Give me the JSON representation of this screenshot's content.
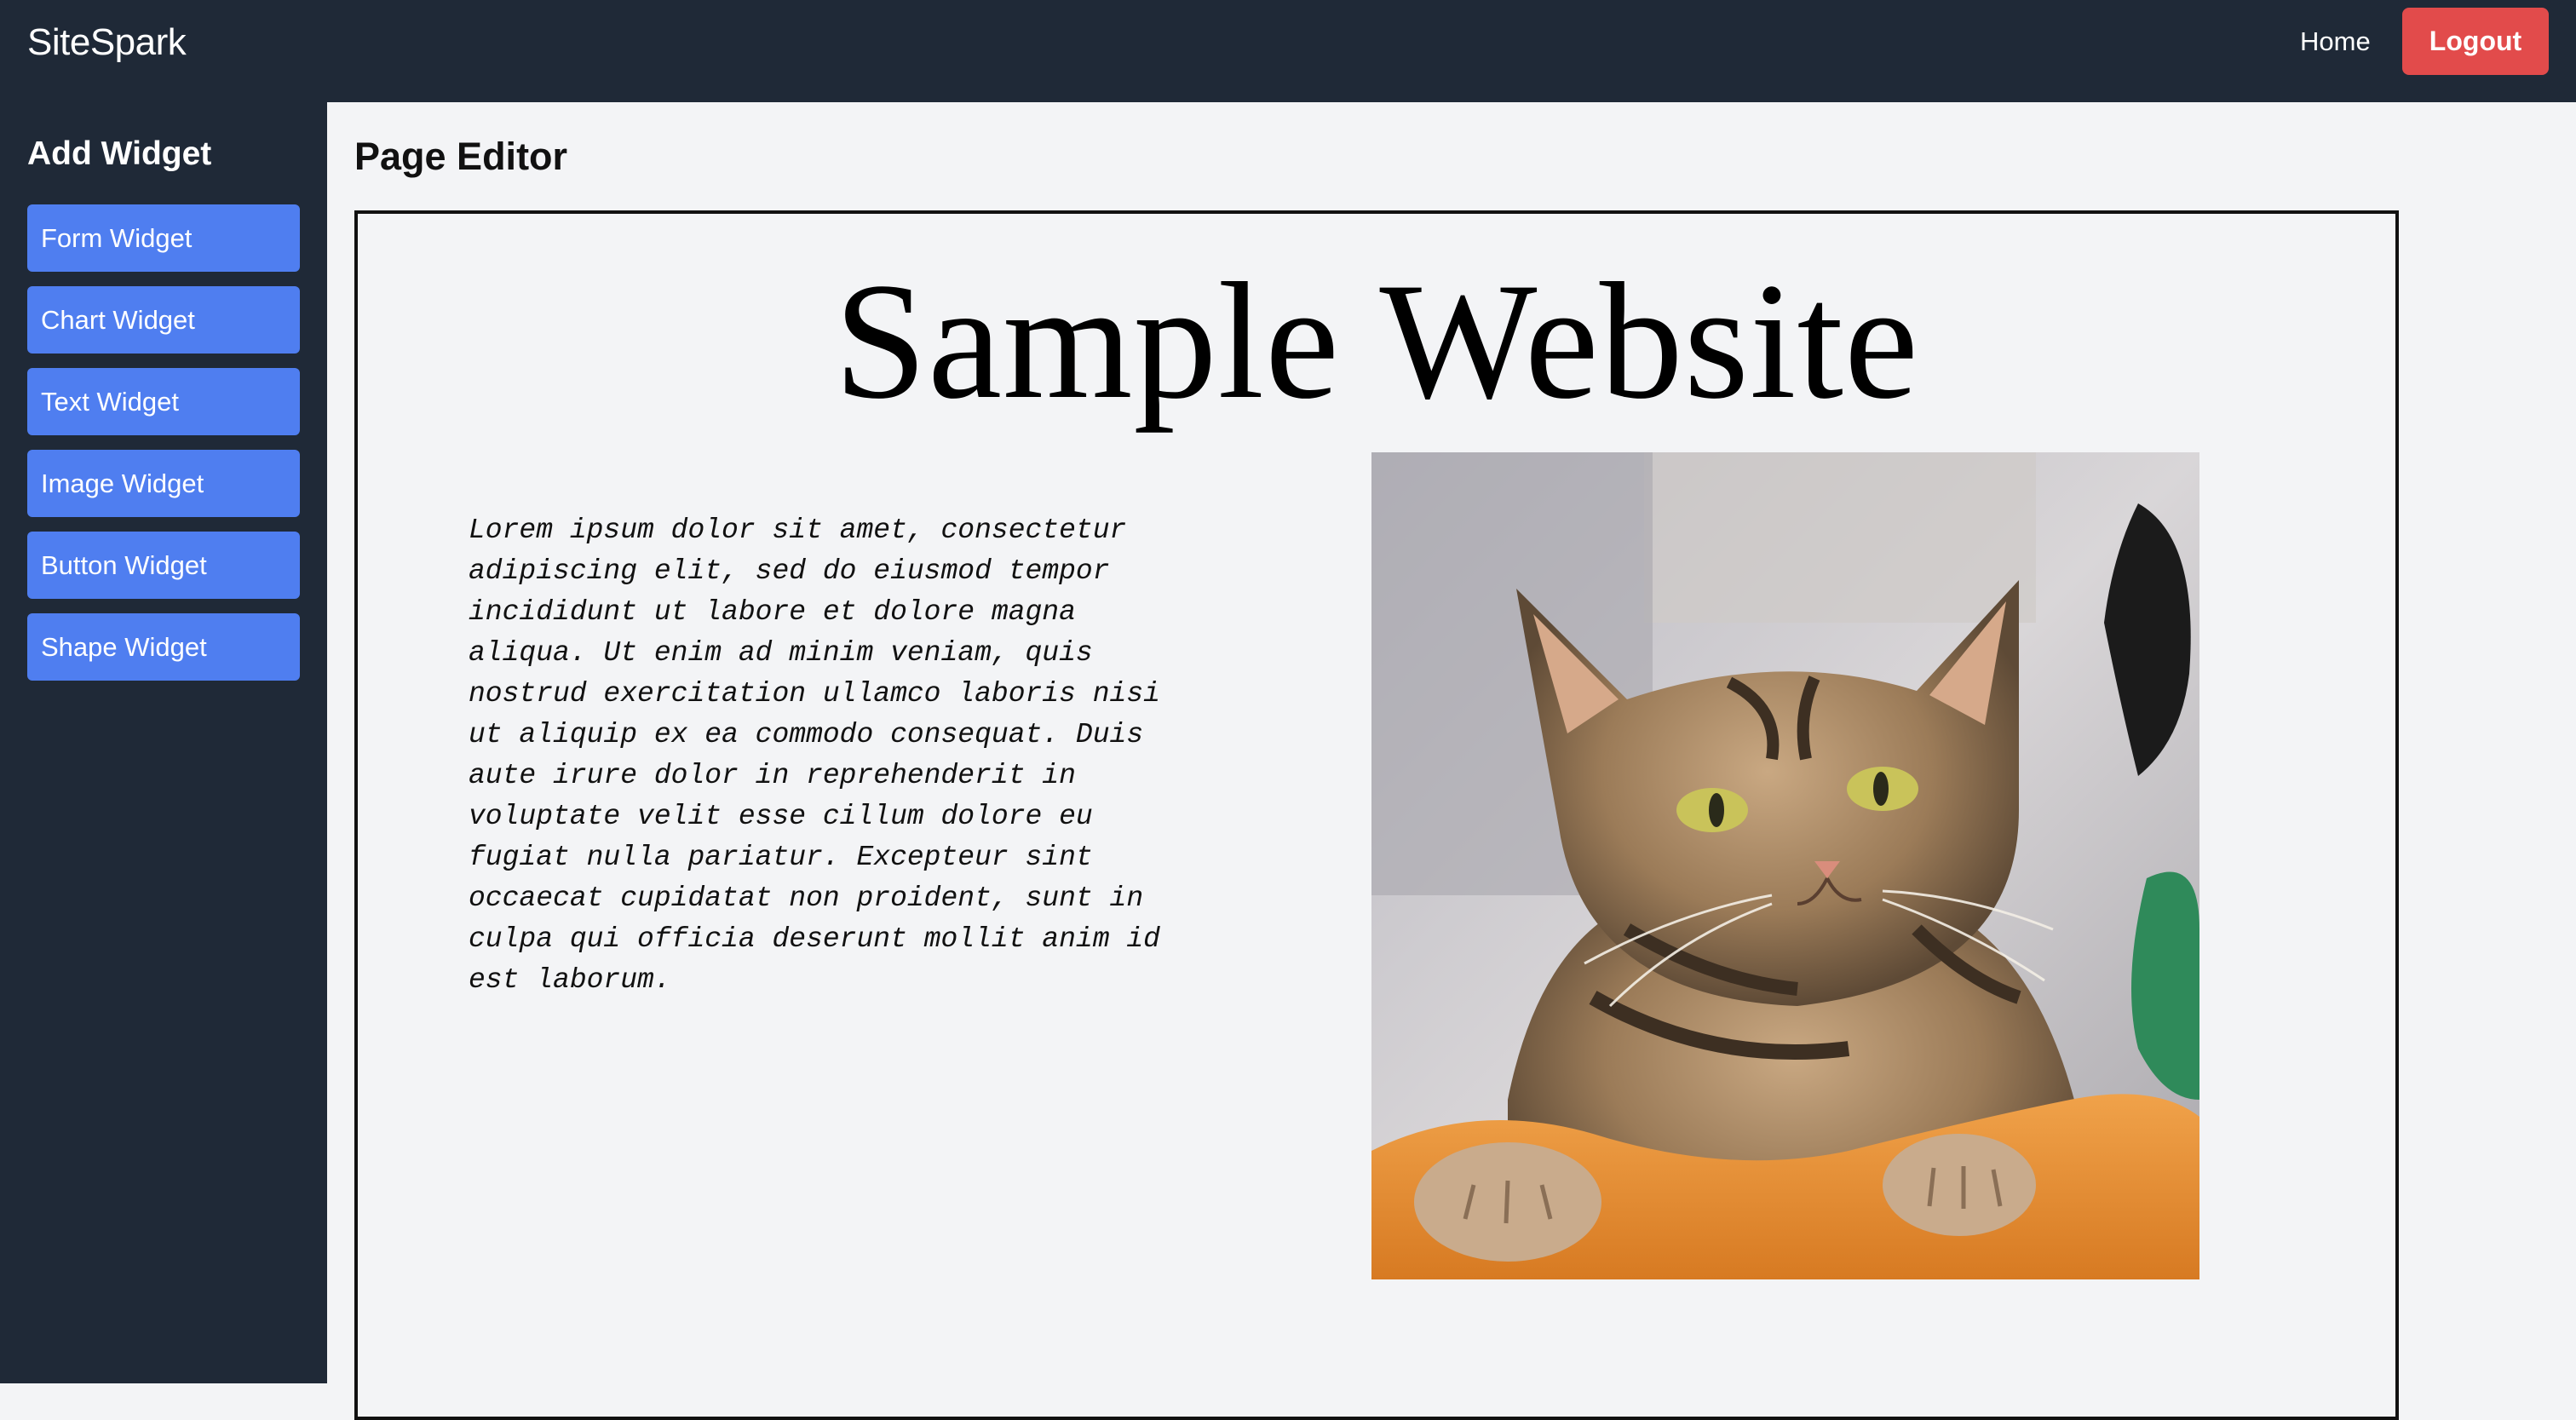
{
  "app": {
    "brand": "SiteSpark",
    "nav": {
      "home_label": "Home",
      "logout_label": "Logout"
    }
  },
  "sidebar": {
    "title": "Add Widget",
    "items": [
      {
        "label": "Form Widget"
      },
      {
        "label": "Chart Widget"
      },
      {
        "label": "Text Widget"
      },
      {
        "label": "Image Widget"
      },
      {
        "label": "Button Widget"
      },
      {
        "label": "Shape Widget"
      }
    ]
  },
  "editor": {
    "title": "Page Editor",
    "page": {
      "heading": "Sample Website",
      "body_text": "Lorem ipsum dolor sit amet, consectetur adipiscing elit, sed do eiusmod tempor incididunt ut labore et dolore magna aliqua. Ut enim ad minim veniam, quis nostrud exercitation ullamco laboris nisi ut aliquip ex ea commodo consequat. Duis aute irure dolor in reprehenderit in voluptate velit esse cillum dolore eu fugiat nulla pariatur. Excepteur sint occaecat cupidatat non proident, sunt in culpa qui officia deserunt mollit anim id est laborum.",
      "image": "tabby-cat-photo"
    }
  },
  "colors": {
    "nav_background": "#1f2937",
    "widget_button": "#4f7ef0",
    "logout_button": "#e24b4b",
    "editor_background": "#f3f4f6"
  }
}
